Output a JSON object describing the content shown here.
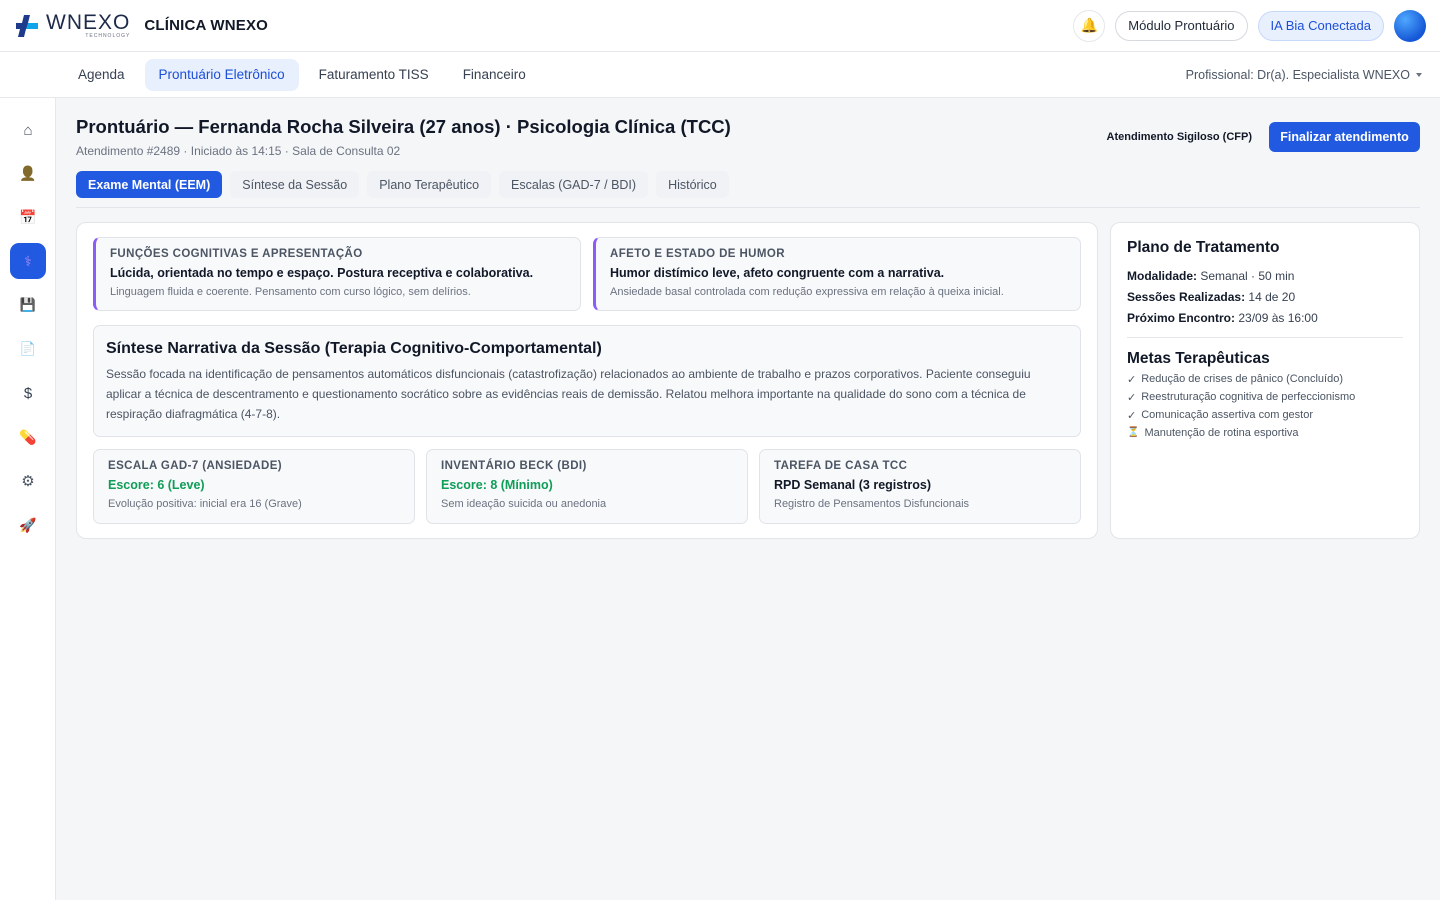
{
  "header": {
    "logo_word": "WNEXO",
    "logo_sub": "TECHNOLOGY",
    "clinic_name": "CLÍNICA WNEXO",
    "module_label": "Módulo Prontuário",
    "ia_label": "IA Bia Conectada"
  },
  "nav": {
    "tabs": [
      {
        "label": "Agenda"
      },
      {
        "label": "Prontuário Eletrônico",
        "active": true
      },
      {
        "label": "Faturamento TISS"
      },
      {
        "label": "Financeiro"
      }
    ],
    "professional": "Profissional: Dr(a). Especialista WNEXO"
  },
  "sidebar": {
    "items": [
      {
        "icon": "home-icon",
        "glyph": "⌂"
      },
      {
        "icon": "user-icon",
        "glyph": "👤"
      },
      {
        "icon": "calendar-icon",
        "glyph": "📅"
      },
      {
        "icon": "stethoscope-icon",
        "glyph": "⚕",
        "active": true
      },
      {
        "icon": "save-icon",
        "glyph": "💾"
      },
      {
        "icon": "document-icon",
        "glyph": "📄"
      },
      {
        "icon": "dollar-icon",
        "glyph": "$"
      },
      {
        "icon": "pill-icon",
        "glyph": "💊"
      },
      {
        "icon": "settings-icon",
        "glyph": "⚙"
      },
      {
        "icon": "rocket-icon",
        "glyph": "🚀"
      }
    ]
  },
  "page": {
    "title": "Prontuário — Fernanda Rocha Silveira (27 anos) · Psicologia Clínica (TCC)",
    "subtitle": "Atendimento #2489 · Iniciado às 14:15 · Sala de Consulta 02",
    "confidential": "Atendimento Sigiloso (CFP)",
    "finish_button": "Finalizar atendimento",
    "tabs": [
      {
        "label": "Exame Mental (EEM)",
        "active": true
      },
      {
        "label": "Síntese da Sessão"
      },
      {
        "label": "Plano Terapêutico"
      },
      {
        "label": "Escalas (GAD-7 / BDI)"
      },
      {
        "label": "Histórico"
      }
    ]
  },
  "exam": {
    "cognitive": {
      "title": "FUNÇÕES COGNITIVAS E APRESENTAÇÃO",
      "main": "Lúcida, orientada no tempo e espaço. Postura receptiva e colaborativa.",
      "note": "Linguagem fluida e coerente. Pensamento com curso lógico, sem delírios."
    },
    "mood": {
      "title": "AFETO E ESTADO DE HUMOR",
      "main": "Humor distímico leve, afeto congruente com a narrativa.",
      "note": "Ansiedade basal controlada com redução expressiva em relação à queixa inicial."
    },
    "synthesis": {
      "title": "Síntese Narrativa da Sessão (Terapia Cognitivo-Comportamental)",
      "text": "Sessão focada na identificação de pensamentos automáticos disfuncionais (catastrofização) relacionados ao ambiente de trabalho e prazos corporativos. Paciente conseguiu aplicar a técnica de descentramento e questionamento socrático sobre as evidências reais de demissão. Relatou melhora importante na qualidade do sono com a técnica de respiração diafragmática (4-7-8)."
    },
    "gad7": {
      "title": "ESCALA GAD-7 (ANSIEDADE)",
      "score": "Escore: 6 (Leve)",
      "note": "Evolução positiva: inicial era 16 (Grave)"
    },
    "bdi": {
      "title": "INVENTÁRIO BECK (BDI)",
      "score": "Escore: 8 (Mínimo)",
      "note": "Sem ideação suicida ou anedonia"
    },
    "homework": {
      "title": "TAREFA DE CASA TCC",
      "main": "RPD Semanal (3 registros)",
      "note": "Registro de Pensamentos Disfuncionais"
    }
  },
  "plan": {
    "title": "Plano de Tratamento",
    "modality_label": "Modalidade:",
    "modality_value": "Semanal · 50 min",
    "sessions_label": "Sessões Realizadas:",
    "sessions_value": "14 de 20",
    "next_label": "Próximo Encontro:",
    "next_value": "23/09 às 16:00",
    "goals_title": "Metas Terapêuticas",
    "goals": [
      {
        "mark": "✓",
        "text": "Redução de crises de pânico (Concluído)"
      },
      {
        "mark": "✓",
        "text": "Reestruturação cognitiva de perfeccionismo"
      },
      {
        "mark": "✓",
        "text": "Comunicação assertiva com gestor"
      },
      {
        "mark": "⏳",
        "text": "Manutenção de rotina esportiva"
      }
    ]
  },
  "colors": {
    "primary": "#2159e0",
    "accent_purple": "#8b5cf6",
    "success_green": "#0f9d58"
  }
}
